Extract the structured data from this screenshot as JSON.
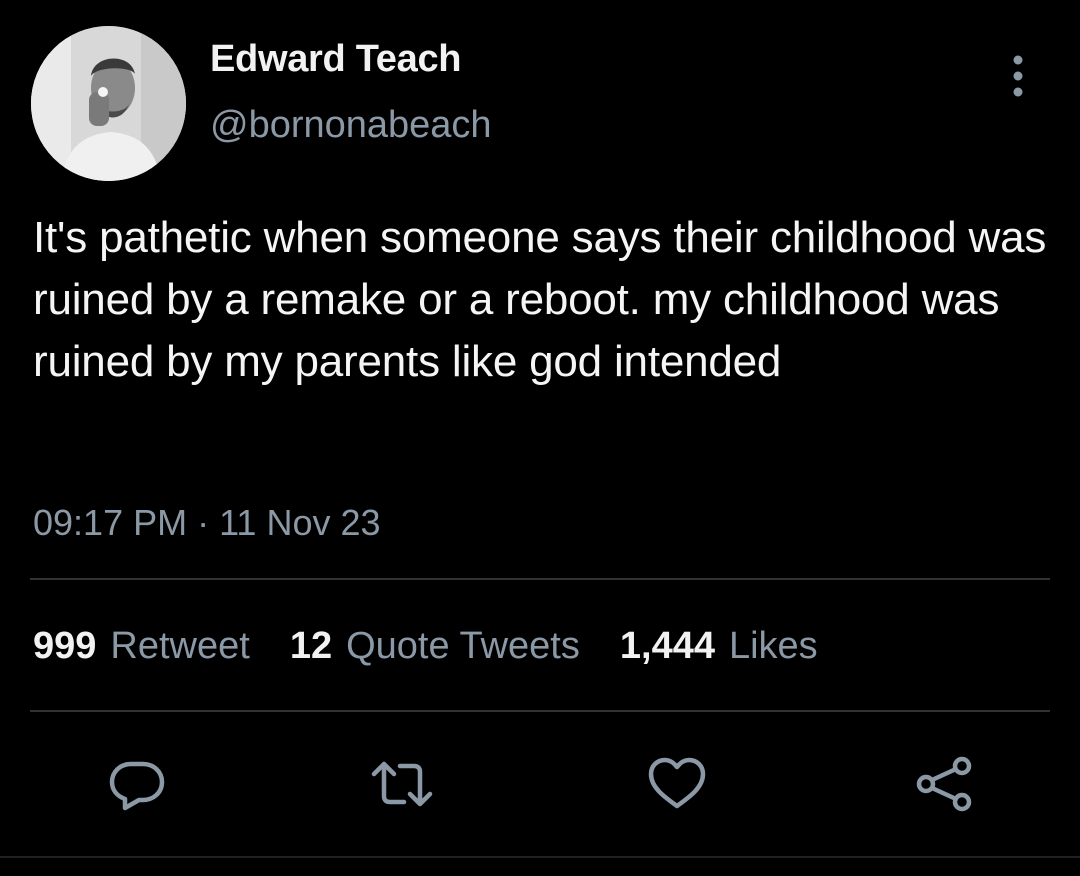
{
  "author": {
    "display_name": "Edward Teach",
    "handle": "@bornonabeach"
  },
  "tweet": {
    "text": "It's pathetic when someone says their childhood was ruined by a remake or a reboot. my childhood was ruined by my parents like god intended",
    "timestamp": "09:17 PM · 11 Nov 23"
  },
  "stats": {
    "retweets": {
      "count": "999",
      "label": "Retweet"
    },
    "quotes": {
      "count": "12",
      "label": "Quote Tweets"
    },
    "likes": {
      "count": "1,444",
      "label": "Likes"
    }
  },
  "icons": {
    "more": "more-vertical-icon",
    "reply": "reply-icon",
    "retweet": "retweet-icon",
    "like": "heart-icon",
    "share": "share-icon"
  },
  "colors": {
    "background": "#000000",
    "primary_text": "#f5f5f5",
    "secondary_text": "#8b98a5",
    "divider": "#2f3336"
  }
}
